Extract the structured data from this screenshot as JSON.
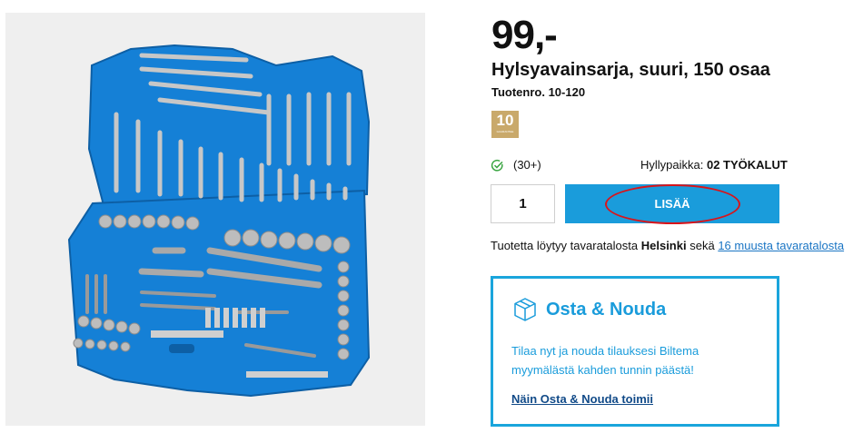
{
  "product": {
    "price": "99,-",
    "title": "Hylsyavainsarja, suuri, 150 osaa",
    "article_number": "Tuotenro. 10-120",
    "warranty_years": "10",
    "warranty_label": "GUARANTEE",
    "image_name": "socket-set-case-image"
  },
  "stock": {
    "count": "(30+)",
    "shelf_label": "Hyllypaikka:",
    "shelf_value": "02 TYÖKALUT"
  },
  "purchase": {
    "quantity": "1",
    "add_button": "LISÄÄ"
  },
  "store_availability": {
    "prefix": "Tuotetta löytyy tavaratalosta",
    "store": "Helsinki",
    "middle": "sekä",
    "link_text": "16 muusta tavaratalosta"
  },
  "pickup": {
    "heading": "Osta & Nouda",
    "description": "Tilaa nyt ja nouda tilauksesi Biltema myymälästä kahden tunnin päästä!",
    "link": "Näin Osta & Nouda toimii"
  },
  "colors": {
    "accent": "#1a9cdb",
    "case_blue": "#1580d6",
    "highlight_ring": "#d9141a",
    "warranty_gold": "#c9a96b"
  }
}
